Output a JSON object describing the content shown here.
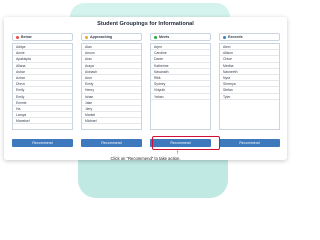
{
  "page": {
    "title": "Student Groupings for Informational"
  },
  "columns": [
    {
      "label": "Below",
      "dot_color": "#e84a3c",
      "students": [
        "Aditya",
        "Annie",
        "Apaksipta",
        "Allana",
        "Ashar",
        "Azhar",
        "Dhruv",
        "Emily",
        "Emily",
        "Emmie",
        "Ha",
        "Lamya",
        "Manelsel"
      ]
    },
    {
      "label": "Approaching",
      "dot_color": "#f2a72f",
      "students": [
        "Alan",
        "Anson",
        "Arav",
        "Araya",
        "Avinash",
        "Arun",
        "Emily",
        "Henry",
        "Ishan",
        "Jake",
        "Jiery",
        "Markel",
        "Michael"
      ]
    },
    {
      "label": "Meets",
      "dot_color": "#28a745",
      "students": [
        "Arjen",
        "Caroline",
        "Dante",
        "Katherine",
        "Navanath",
        "Ritik",
        "Sydney",
        "Vidyuth",
        "Yahan"
      ]
    },
    {
      "label": "Exceeds",
      "dot_color": "#3b82c4",
      "students": [
        "Alexi",
        "Allison",
        "Chloe",
        "Medha",
        "Navneeth",
        "Nyra",
        "Shreeya",
        "Stefan",
        "Tyler"
      ]
    }
  ],
  "recommend_label": "Recommend",
  "hint": "Click on \"Recommend\" to take action.",
  "highlight_color": "#d0103a",
  "button_color": "#3f79bd",
  "arrow_glyph": "↑"
}
